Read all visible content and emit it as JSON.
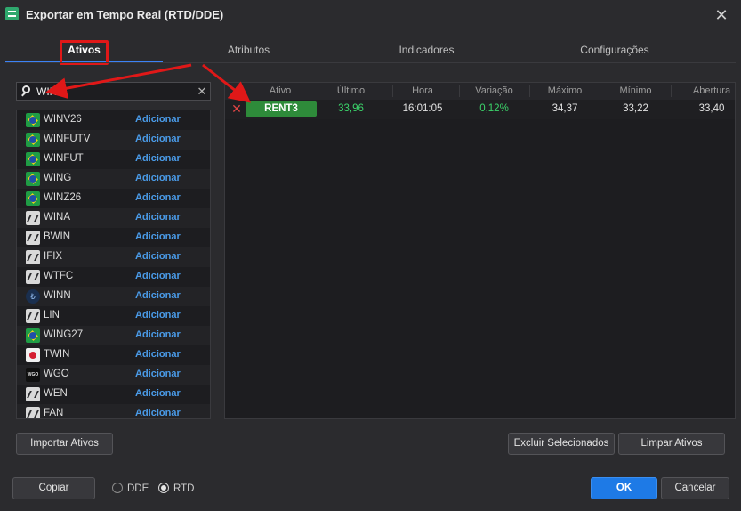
{
  "window": {
    "title": "Exportar em Tempo Real (RTD/DDE)",
    "close_glyph": "✕"
  },
  "tabs": [
    {
      "label": "Ativos",
      "active": true
    },
    {
      "label": "Atributos",
      "active": false
    },
    {
      "label": "Indicadores",
      "active": false
    },
    {
      "label": "Configurações",
      "active": false
    }
  ],
  "search": {
    "value": "WIN",
    "clear_glyph": "✕"
  },
  "assets": [
    {
      "symbol": "WINV26",
      "icon": "brazil-flag-icon",
      "action": "Adicionar"
    },
    {
      "symbol": "WINFUTV",
      "icon": "brazil-flag-icon",
      "action": "Adicionar"
    },
    {
      "symbol": "WINFUT",
      "icon": "brazil-flag-icon",
      "action": "Adicionar"
    },
    {
      "symbol": "WING",
      "icon": "brazil-flag-icon",
      "action": "Adicionar"
    },
    {
      "symbol": "WINZ26",
      "icon": "brazil-flag-icon",
      "action": "Adicionar"
    },
    {
      "symbol": "WINA",
      "icon": "index-icon",
      "action": "Adicionar"
    },
    {
      "symbol": "BWIN",
      "icon": "index-icon",
      "action": "Adicionar"
    },
    {
      "symbol": "IFIX",
      "icon": "index-icon",
      "action": "Adicionar"
    },
    {
      "symbol": "WTFC",
      "icon": "index-icon",
      "action": "Adicionar"
    },
    {
      "symbol": "WINN",
      "icon": "currency-icon",
      "action": "Adicionar"
    },
    {
      "symbol": "LIN",
      "icon": "index-icon",
      "action": "Adicionar"
    },
    {
      "symbol": "WING27",
      "icon": "brazil-flag-icon",
      "action": "Adicionar"
    },
    {
      "symbol": "TWIN",
      "icon": "company-logo-icon",
      "action": "Adicionar"
    },
    {
      "symbol": "WGO",
      "icon": "wgo-logo-icon",
      "action": "Adicionar"
    },
    {
      "symbol": "WEN",
      "icon": "index-icon",
      "action": "Adicionar"
    },
    {
      "symbol": "FAN",
      "icon": "index-icon",
      "action": "Adicionar"
    }
  ],
  "table": {
    "columns": [
      "Ativo",
      "Último",
      "Hora",
      "Variação",
      "Máximo",
      "Mínimo",
      "Abertura"
    ],
    "rows": [
      {
        "remove_glyph": "✕",
        "ativo": "RENT3",
        "ultimo": "33,96",
        "hora": "16:01:05",
        "variacao": "0,12%",
        "maximo": "34,37",
        "minimo": "33,22",
        "abertura": "33,40"
      }
    ]
  },
  "buttons": {
    "importar": "Importar Ativos",
    "excluir": "Excluir Selecionados",
    "limpar": "Limpar Ativos",
    "copiar": "Copiar",
    "ok": "OK",
    "cancelar": "Cancelar"
  },
  "mode": {
    "options": [
      "DDE",
      "RTD"
    ],
    "selected": "RTD"
  },
  "colors": {
    "accent": "#1e7ae6",
    "positive": "#3bd36a",
    "ticker_badge": "#2e8b3a",
    "annotation": "#e01818"
  }
}
